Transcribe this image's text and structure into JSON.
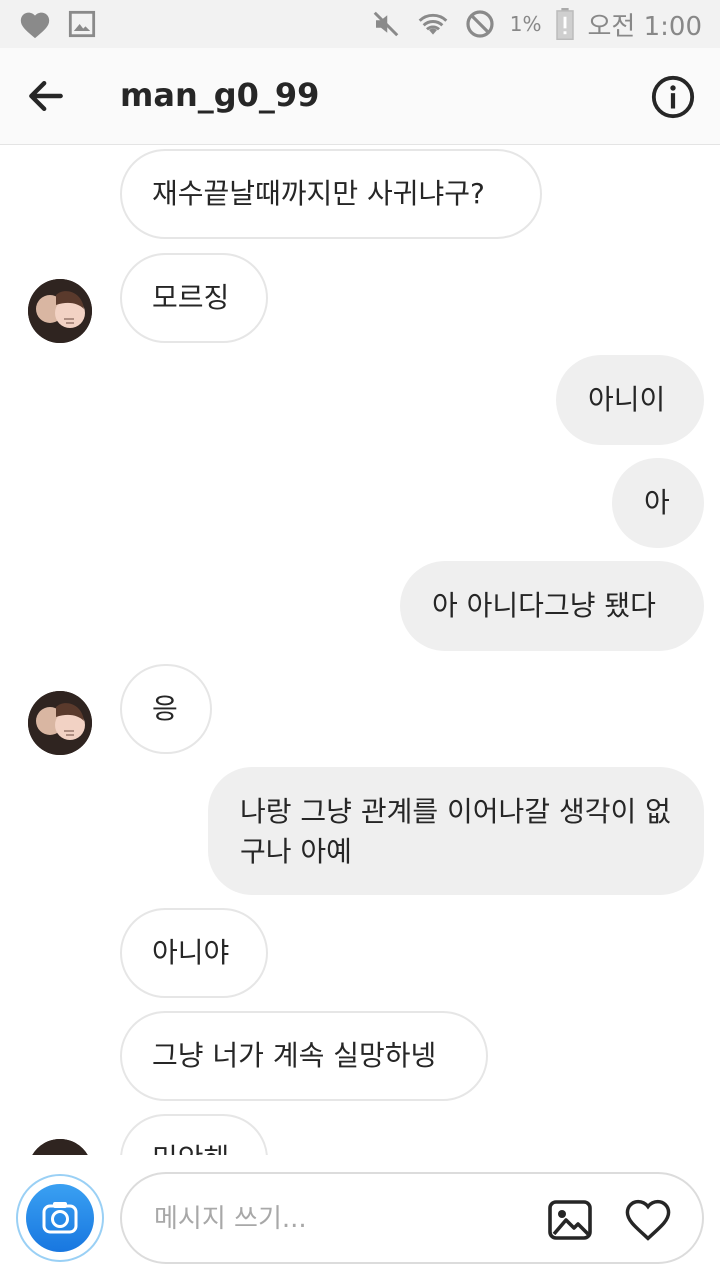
{
  "status_bar": {
    "icons_left": [
      "heart-icon",
      "image-icon"
    ],
    "icons_right": [
      "mute-icon",
      "wifi-icon",
      "blocked-icon",
      "battery-icon"
    ],
    "battery_percent": "1%",
    "time": "오전 1:00"
  },
  "header": {
    "back_icon": "arrow-left-icon",
    "username": "man_g0_99",
    "info_icon": "info-icon"
  },
  "messages": [
    {
      "side": "received",
      "text": "재수끝날때까지만 사귀냐구?"
    },
    {
      "side": "received",
      "text": "모르징",
      "avatar": true
    },
    {
      "side": "sent",
      "text": "아니이"
    },
    {
      "side": "sent",
      "text": "아"
    },
    {
      "side": "sent",
      "text": "아 아니다그냥 됐다"
    },
    {
      "side": "received",
      "text": "응",
      "avatar": true
    },
    {
      "side": "sent",
      "text": "나랑 그냥 관계를 이어나갈 생각이 없구나 아예"
    },
    {
      "side": "received",
      "text": "아니야"
    },
    {
      "side": "received",
      "text": "그냥 너가 계속 실망하넹"
    },
    {
      "side": "received",
      "text": "미안해",
      "avatar": true
    }
  ],
  "composer": {
    "placeholder": "메시지 쓰기...",
    "camera_icon": "camera-icon",
    "gallery_icon": "gallery-icon",
    "like_icon": "heart-icon"
  },
  "colors": {
    "accent": "#1877e0",
    "sent_bubble": "#efefef",
    "received_border": "#e6e6e6"
  }
}
